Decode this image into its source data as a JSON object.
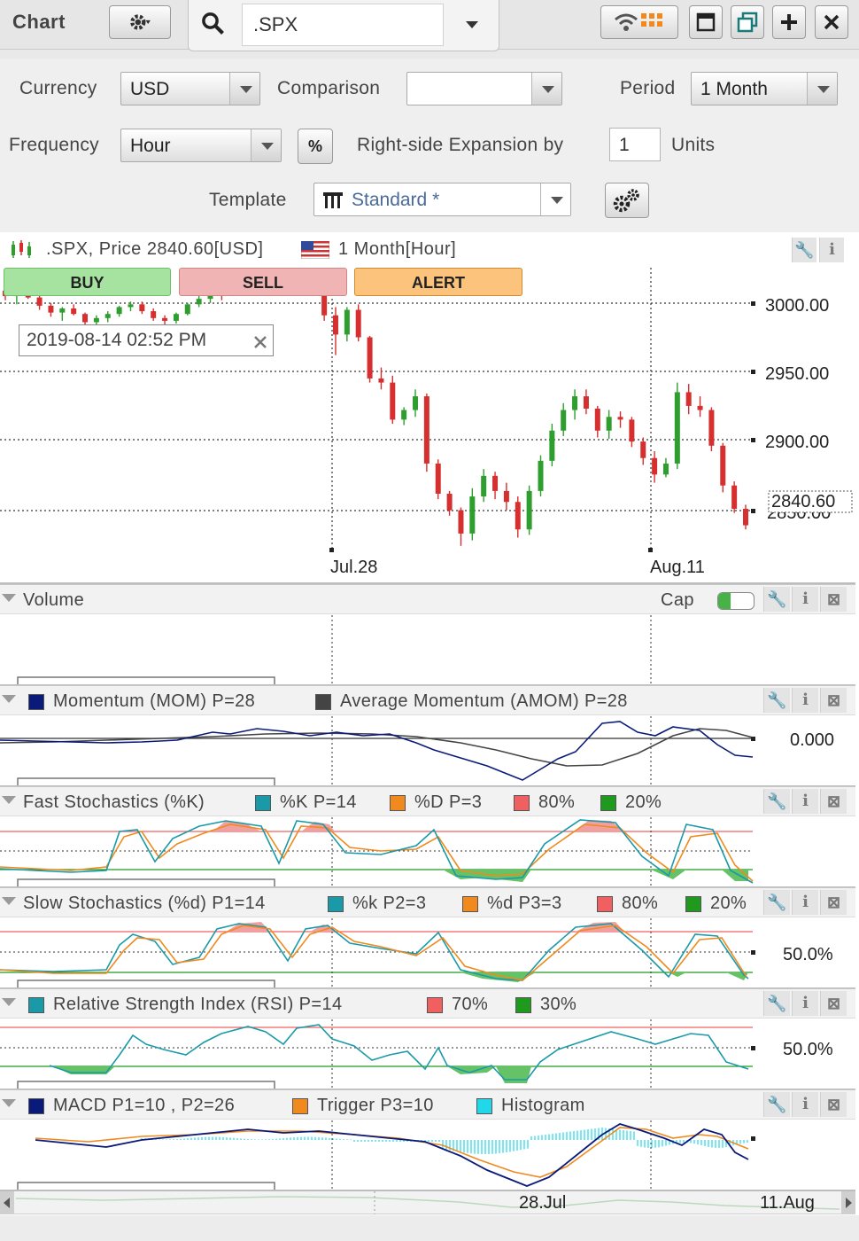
{
  "topbar": {
    "title": "Chart",
    "search_value": ".SPX"
  },
  "settings": {
    "currency_label": "Currency",
    "currency_value": "USD",
    "comparison_label": "Comparison",
    "comparison_value": "",
    "period_label": "Period",
    "period_value": "1 Month",
    "frequency_label": "Frequency",
    "frequency_value": "Hour",
    "percent_symbol": "%",
    "expansion_label": "Right-side Expansion by",
    "expansion_value": "1",
    "units_label": "Units",
    "template_label": "Template",
    "template_value": "Standard *"
  },
  "price_panel": {
    "title": ".SPX, Price 2840.60[USD]",
    "period_info": "1 Month[Hour]",
    "buy_label": "BUY",
    "sell_label": "SELL",
    "alert_label": "ALERT",
    "crosshair_date": "2019-08-14 02:52 PM",
    "last_price": "2840.60",
    "y_labels": [
      "3000.00",
      "2950.00",
      "2900.00",
      "2850.00"
    ],
    "x_labels": [
      "Jul.28",
      "Aug.11"
    ]
  },
  "volume_panel": {
    "title": "Volume",
    "cap_label": "Cap"
  },
  "momentum_panel": {
    "mom_label": "Momentum (MOM) P=28",
    "amom_label": "Average Momentum (AMOM) P=28",
    "y_label": "0.000"
  },
  "fast_stoch_panel": {
    "title": "Fast Stochastics (%K)",
    "k_label": "%K P=14",
    "d_label": "%D P=3",
    "upper_label": "80%",
    "lower_label": "20%"
  },
  "slow_stoch_panel": {
    "title": "Slow Stochastics (%d) P1=14",
    "k_label": "%k P2=3",
    "d_label": "%d P3=3",
    "upper_label": "80%",
    "lower_label": "20%",
    "y_label": "50.0%"
  },
  "rsi_panel": {
    "title": "Relative Strength Index (RSI) P=14",
    "upper_label": "70%",
    "lower_label": "30%",
    "y_label": "50.0%"
  },
  "macd_panel": {
    "title": "MACD P1=10   , P2=26",
    "trigger_label": "Trigger P3=10",
    "hist_label": "Histogram"
  },
  "navigator": {
    "x_labels": [
      "28.Jul",
      "11.Aug"
    ]
  },
  "colors": {
    "up": "#2e9e2e",
    "down": "#d62f2f",
    "mom": "#0a1a7a",
    "amom": "#444444",
    "stoch_k": "#1a9aa8",
    "stoch_d": "#f08a1e",
    "band_upper": "#f06060",
    "band_lower": "#1f9a1f",
    "histogram": "#20d8e8"
  },
  "chart_data": {
    "type": "candlestick",
    "y_range": [
      2822,
      3030
    ],
    "candles": [
      [
        3012,
        3016,
        3005,
        3008
      ],
      [
        3008,
        3012,
        3002,
        3010
      ],
      [
        3010,
        3014,
        3006,
        3007
      ],
      [
        3007,
        3009,
        2998,
        3001
      ],
      [
        3001,
        3003,
        2993,
        2996
      ],
      [
        2996,
        3000,
        2990,
        2999
      ],
      [
        2999,
        3002,
        2994,
        2995
      ],
      [
        2995,
        2996,
        2986,
        2989
      ],
      [
        2989,
        2994,
        2985,
        2992
      ],
      [
        2992,
        2997,
        2989,
        2995
      ],
      [
        2995,
        3001,
        2993,
        3000
      ],
      [
        3000,
        3004,
        2997,
        3002
      ],
      [
        3002,
        3004,
        2995,
        2997
      ],
      [
        2997,
        2999,
        2990,
        2992
      ],
      [
        2992,
        2994,
        2987,
        2990
      ],
      [
        2990,
        2996,
        2988,
        2995
      ],
      [
        2995,
        3003,
        2994,
        3002
      ],
      [
        3002,
        3008,
        3000,
        3006
      ],
      [
        3006,
        3011,
        3003,
        3010
      ],
      [
        3010,
        3013,
        3005,
        3009
      ],
      [
        3009,
        3016,
        3008,
        3015
      ],
      [
        3015,
        3021,
        3013,
        3019
      ],
      [
        3019,
        3025,
        3016,
        3023
      ],
      [
        3023,
        3026,
        3018,
        3020
      ],
      [
        3020,
        3022,
        3010,
        3012
      ],
      [
        3012,
        3016,
        3008,
        3014
      ],
      [
        3014,
        3018,
        3010,
        3013
      ],
      [
        3013,
        3017,
        3009,
        3016
      ],
      [
        3016,
        3018,
        2990,
        2994
      ],
      [
        2994,
        3000,
        2965,
        2980
      ],
      [
        2980,
        3000,
        2975,
        2998
      ],
      [
        2998,
        3002,
        2975,
        2978
      ],
      [
        2978,
        2979,
        2945,
        2948
      ],
      [
        2948,
        2956,
        2940,
        2945
      ],
      [
        2945,
        2950,
        2915,
        2918
      ],
      [
        2918,
        2927,
        2914,
        2925
      ],
      [
        2925,
        2940,
        2920,
        2935
      ],
      [
        2935,
        2937,
        2880,
        2886
      ],
      [
        2886,
        2889,
        2860,
        2864
      ],
      [
        2864,
        2866,
        2848,
        2852
      ],
      [
        2852,
        2854,
        2826,
        2835
      ],
      [
        2835,
        2868,
        2830,
        2862
      ],
      [
        2862,
        2882,
        2858,
        2877
      ],
      [
        2877,
        2880,
        2860,
        2866
      ],
      [
        2866,
        2872,
        2852,
        2858
      ],
      [
        2858,
        2862,
        2832,
        2838
      ],
      [
        2838,
        2870,
        2834,
        2866
      ],
      [
        2866,
        2892,
        2862,
        2888
      ],
      [
        2888,
        2915,
        2884,
        2910
      ],
      [
        2910,
        2930,
        2906,
        2925
      ],
      [
        2925,
        2940,
        2918,
        2935
      ],
      [
        2935,
        2940,
        2922,
        2926
      ],
      [
        2926,
        2928,
        2905,
        2910
      ],
      [
        2910,
        2925,
        2904,
        2920
      ],
      [
        2920,
        2924,
        2912,
        2918
      ],
      [
        2918,
        2920,
        2898,
        2902
      ],
      [
        2902,
        2905,
        2885,
        2890
      ],
      [
        2890,
        2895,
        2872,
        2878
      ],
      [
        2878,
        2890,
        2876,
        2886
      ],
      [
        2886,
        2945,
        2882,
        2938
      ],
      [
        2938,
        2944,
        2922,
        2928
      ],
      [
        2928,
        2935,
        2920,
        2925
      ],
      [
        2925,
        2927,
        2895,
        2899
      ],
      [
        2899,
        2901,
        2865,
        2870
      ],
      [
        2870,
        2873,
        2850,
        2853
      ],
      [
        2853,
        2856,
        2838,
        2841
      ]
    ]
  }
}
